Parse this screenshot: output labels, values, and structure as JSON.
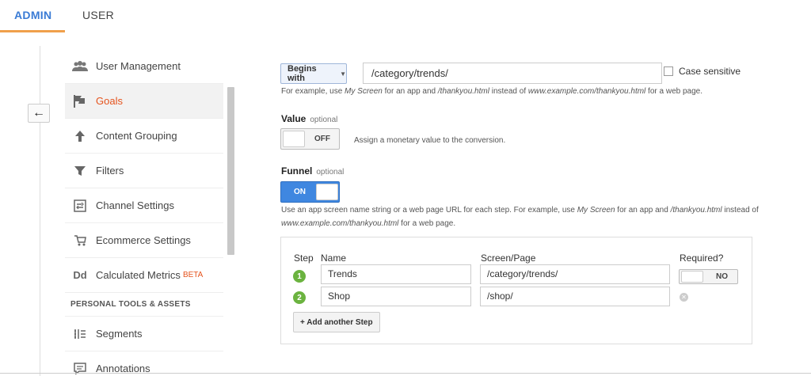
{
  "tabs": {
    "admin": "ADMIN",
    "user": "USER"
  },
  "back_button": "←",
  "nav": {
    "items": [
      {
        "label": "User Management",
        "icon": "users-icon"
      },
      {
        "label": "Goals",
        "icon": "flag-icon",
        "active": true
      },
      {
        "label": "Content Grouping",
        "icon": "content-grouping-icon"
      },
      {
        "label": "Filters",
        "icon": "filter-icon"
      },
      {
        "label": "Channel Settings",
        "icon": "channel-settings-icon"
      },
      {
        "label": "Ecommerce Settings",
        "icon": "cart-icon"
      },
      {
        "label": "Calculated Metrics",
        "icon": "dd-icon",
        "badge": "BETA"
      }
    ],
    "section_header": "PERSONAL TOOLS & ASSETS",
    "section_items": [
      {
        "label": "Segments",
        "icon": "segments-icon"
      },
      {
        "label": "Annotations",
        "icon": "annotations-icon"
      }
    ]
  },
  "destination": {
    "match_type": "Begins with",
    "url_value": "/category/trends/",
    "case_sensitive_label": "Case sensitive",
    "help_prefix": "For example, use ",
    "help_em1": "My Screen",
    "help_mid": " for an app and ",
    "help_em2": "/thankyou.html",
    "help_mid2": " instead of ",
    "help_em3": "www.example.com/thankyou.html",
    "help_suffix": " for a web page."
  },
  "value": {
    "title": "Value",
    "optional": "optional",
    "toggle": "OFF",
    "help": "Assign a monetary value to the conversion."
  },
  "funnel": {
    "title": "Funnel",
    "optional": "optional",
    "toggle": "ON",
    "help_prefix": "Use an app screen name string or a web page URL for each step. For example, use ",
    "help_em1": "My Screen",
    "help_mid": " for an app and ",
    "help_em2": "/thankyou.html",
    "help_mid2": " instead of ",
    "help_em3": "www.example.com/thankyou.html",
    "help_suffix": " for a web page.",
    "headers": {
      "step": "Step",
      "name": "Name",
      "screen": "Screen/Page",
      "required": "Required?"
    },
    "steps": [
      {
        "num": "1",
        "name": "Trends",
        "screen": "/category/trends/",
        "required": "NO"
      },
      {
        "num": "2",
        "name": "Shop",
        "screen": "/shop/"
      }
    ],
    "add_step": "+ Add another Step"
  },
  "colors": {
    "accent": "#3a7bd5",
    "active_nav": "#e5541e",
    "tab_underline": "#f0a04b",
    "step_badge": "#6bb33f",
    "toggle_on": "#3f87e0"
  }
}
